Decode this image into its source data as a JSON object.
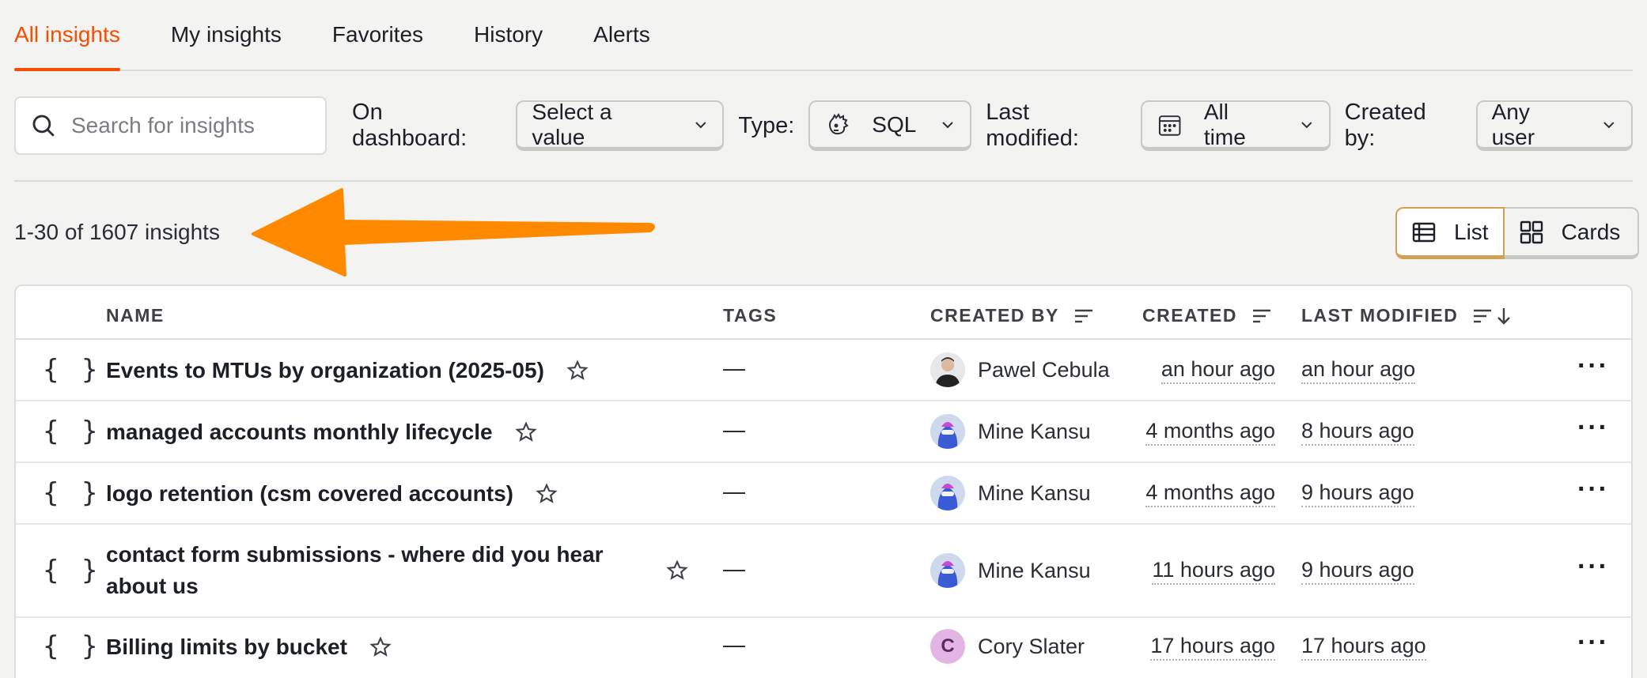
{
  "tabs": [
    {
      "label": "All insights",
      "active": true
    },
    {
      "label": "My insights"
    },
    {
      "label": "Favorites"
    },
    {
      "label": "History"
    },
    {
      "label": "Alerts"
    }
  ],
  "filters": {
    "search_placeholder": "Search for insights",
    "dashboard_label": "On dashboard:",
    "dashboard_value": "Select a value",
    "type_label": "Type:",
    "type_value": "SQL",
    "modified_label": "Last modified:",
    "modified_value": "All time",
    "created_by_label": "Created by:",
    "created_by_value": "Any user"
  },
  "count_text": "1-30 of 1607 insights",
  "view": {
    "list_label": "List",
    "cards_label": "Cards"
  },
  "columns": {
    "name": "NAME",
    "tags": "TAGS",
    "created_by": "CREATED BY",
    "created": "CREATED",
    "last_modified": "LAST MODIFIED"
  },
  "rows": [
    {
      "icon": "{ }",
      "name": "Events to MTUs by organization (2025-05)",
      "tags": "—",
      "creator": "Pawel Cebula",
      "avatar": "photo",
      "created": "an hour ago",
      "modified": "an hour ago"
    },
    {
      "icon": "{ }",
      "name": "managed accounts monthly lifecycle",
      "tags": "—",
      "creator": "Mine Kansu",
      "avatar": "hedgehog",
      "created": "4 months ago",
      "modified": "8 hours ago"
    },
    {
      "icon": "{ }",
      "name": "logo retention (csm covered accounts)",
      "tags": "—",
      "creator": "Mine Kansu",
      "avatar": "hedgehog",
      "created": "4 months ago",
      "modified": "9 hours ago"
    },
    {
      "icon": "{ }",
      "name_line1": "contact form submissions - where did you hear",
      "name_line2": "about us",
      "tags": "—",
      "creator": "Mine Kansu",
      "avatar": "hedgehog",
      "created": "11 hours ago",
      "modified": "9 hours ago"
    },
    {
      "icon": "{ }",
      "name": "Billing limits by bucket",
      "tags": "—",
      "creator": "Cory Slater",
      "avatar": "C",
      "created": "17 hours ago",
      "modified": "17 hours ago"
    }
  ],
  "more_glyph": "···",
  "colors": {
    "accent": "#f54e00",
    "arrow": "#ff8a00"
  }
}
